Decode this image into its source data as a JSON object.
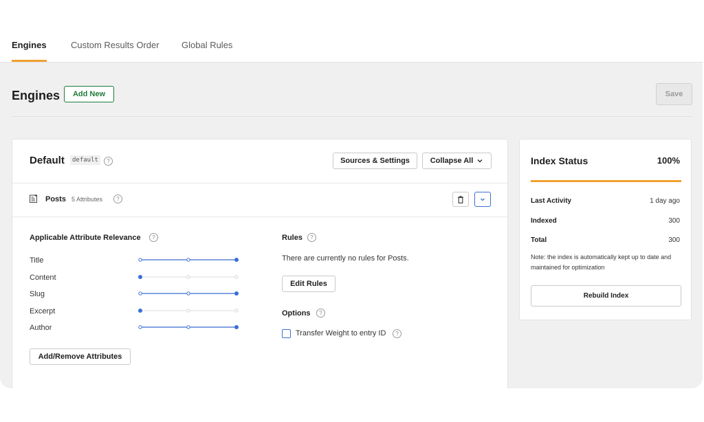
{
  "tabs": [
    {
      "label": "Engines"
    },
    {
      "label": "Custom Results Order"
    },
    {
      "label": "Global Rules"
    }
  ],
  "header": {
    "title": "Engines",
    "add_new": "Add New",
    "save": "Save"
  },
  "engine": {
    "name": "Default",
    "code": "default",
    "sources_settings": "Sources & Settings",
    "collapse_all": "Collapse All",
    "source": {
      "label": "Posts",
      "attribute_count": "5 Attributes"
    },
    "relevance": {
      "title": "Applicable Attribute Relevance",
      "attributes": [
        {
          "name": "Title",
          "weight": 1.0
        },
        {
          "name": "Content",
          "weight": 0.0
        },
        {
          "name": "Slug",
          "weight": 1.0
        },
        {
          "name": "Excerpt",
          "weight": 0.0
        },
        {
          "name": "Author",
          "weight": 1.0
        }
      ],
      "add_remove": "Add/Remove Attributes"
    },
    "rules": {
      "title": "Rules",
      "empty_text": "There are currently no rules for Posts.",
      "edit_rules": "Edit Rules"
    },
    "options": {
      "title": "Options",
      "transfer_weight_label": "Transfer Weight to entry ID",
      "transfer_weight_checked": false
    }
  },
  "index_status": {
    "title": "Index Status",
    "percent": "100%",
    "progress": 1.0,
    "stats": [
      {
        "label": "Last Activity",
        "value": "1 day ago"
      },
      {
        "label": "Indexed",
        "value": "300"
      },
      {
        "label": "Total",
        "value": "300"
      }
    ],
    "note": "Note: the index is automatically kept up to date and maintained for optimization",
    "rebuild": "Rebuild Index"
  },
  "colors": {
    "accent": "#f0a030",
    "slider": "#3b6fd6",
    "add_new": "#1f7a3a"
  },
  "icons": [
    "help-icon",
    "document-icon",
    "trash-icon",
    "chevron-down-icon"
  ]
}
